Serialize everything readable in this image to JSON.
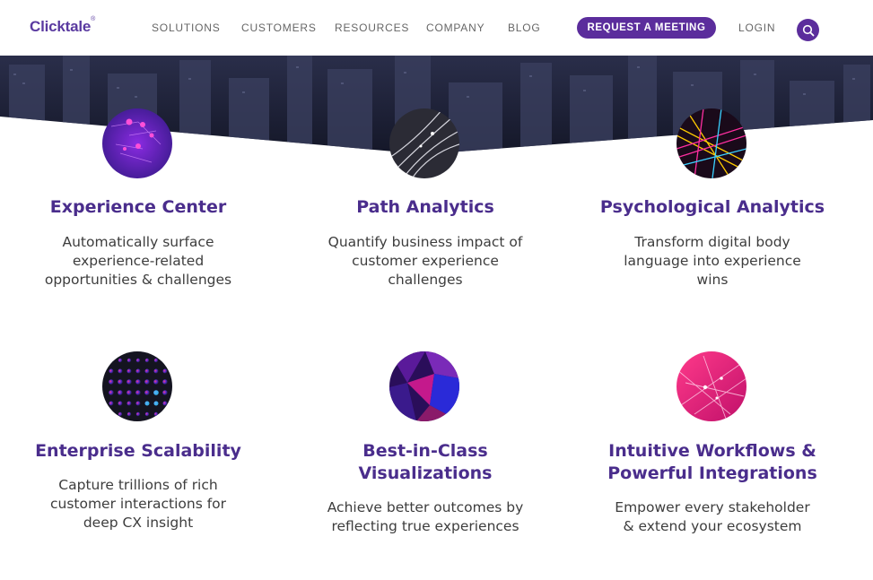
{
  "nav": {
    "logo": "Clicktale",
    "logo_mark": "®",
    "links": [
      "SOLUTIONS",
      "CUSTOMERS",
      "RESOURCES",
      "COMPANY",
      "BLOG"
    ],
    "cta": "REQUEST A MEETING",
    "login": "LOGIN",
    "search_icon": "search-icon"
  },
  "colors": {
    "brand_purple": "#5b2d9c",
    "title_purple": "#4a2d8c",
    "hero_dark": "#1b1f38"
  },
  "features": [
    {
      "title": "Experience Center",
      "desc": [
        "Automatically surface",
        "experience-related",
        "opportunities & challenges"
      ],
      "icon": "network-purple-icon"
    },
    {
      "title": "Path Analytics",
      "desc": [
        "Quantify business impact of",
        "customer experience",
        "challenges"
      ],
      "icon": "light-trails-icon"
    },
    {
      "title": "Psychological Analytics",
      "desc": [
        "Transform digital body",
        "language into experience",
        "wins"
      ],
      "icon": "neon-grid-icon"
    },
    {
      "title": "Enterprise Scalability",
      "desc": [
        "Capture trillions of rich",
        "customer interactions for",
        "deep CX insight"
      ],
      "icon": "dot-sphere-icon"
    },
    {
      "title_lines": [
        "Best-in-Class",
        "Visualizations"
      ],
      "desc": [
        "Achieve better outcomes by",
        "reflecting true experiences"
      ],
      "icon": "polygon-shards-icon"
    },
    {
      "title_lines": [
        "Intuitive Workflows &",
        "Powerful Integrations"
      ],
      "desc": [
        "Empower every stakeholder",
        "& extend your ecosystem"
      ],
      "icon": "pink-network-icon"
    }
  ]
}
